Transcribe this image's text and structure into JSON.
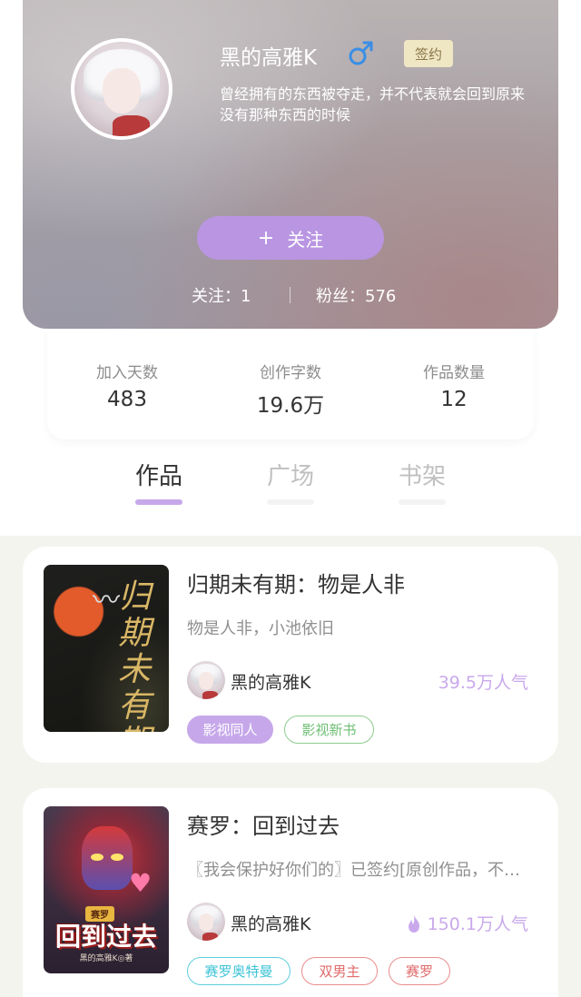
{
  "profile": {
    "username": "黑的高雅K",
    "gender_icon": "male-icon",
    "sign_badge": "签约",
    "bio": "曾经拥有的东西被夺走，并不代表就会回到原来没有那种东西的时候",
    "follow_button": {
      "plus": "+",
      "label": "关注"
    },
    "following": "关注：1",
    "fans": "粉丝：576"
  },
  "stats": [
    {
      "label": "加入天数",
      "value": "483"
    },
    {
      "label": "创作字数",
      "value": "19.6万"
    },
    {
      "label": "作品数量",
      "value": "12"
    }
  ],
  "tabs": [
    {
      "label": "作品",
      "active": true
    },
    {
      "label": "广场",
      "active": false
    },
    {
      "label": "书架",
      "active": false
    }
  ],
  "works": [
    {
      "title": "归期未有期：物是人非",
      "desc": "物是人非，小池依旧",
      "author": "黑的高雅K",
      "popularity": "39.5万人气",
      "cover_text": "归期未有期",
      "tags": [
        "影视同人",
        "影视新书"
      ]
    },
    {
      "title": "赛罗：回到过去",
      "desc": "〖我会保护好你们的〗已签约[原创作品，不喜勿喷]",
      "author": "黑的高雅K",
      "popularity": "150.1万人气",
      "popularity_icon": "flame-icon",
      "cover_text": "回到过去",
      "cover_small": "赛罗",
      "cover_author": "黑的高雅K◎著",
      "tags": [
        "赛罗奥特曼",
        "双男主",
        "赛罗"
      ]
    }
  ],
  "colors": {
    "accent": "#c6a8ea",
    "follow_button": "#b995e2",
    "badge_bg": "#efe6c4",
    "gender_icon": "#3a8ee6"
  }
}
